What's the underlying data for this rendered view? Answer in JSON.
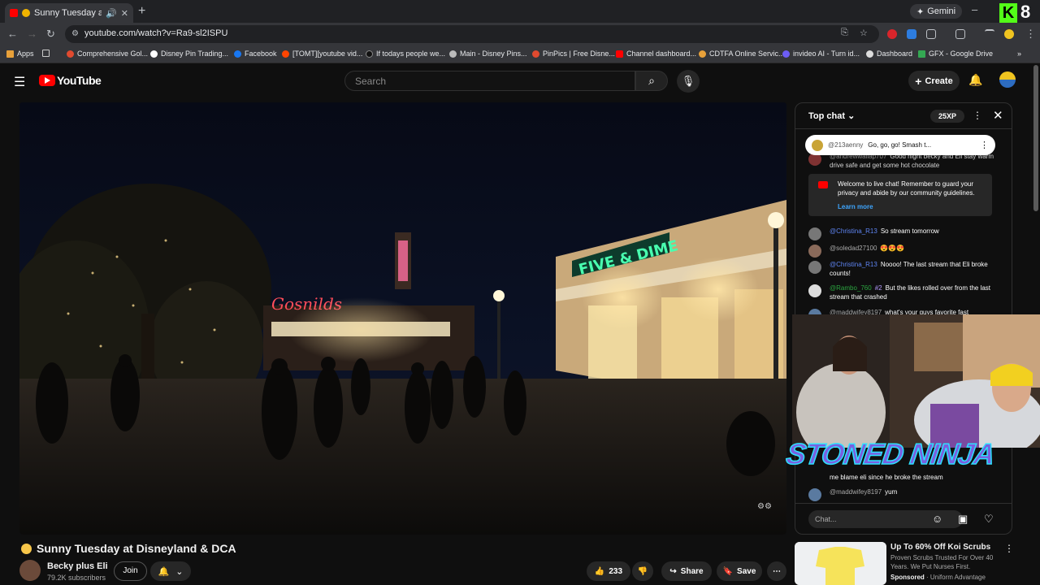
{
  "browser": {
    "tab_title": "Sunny Tuesday at Disne",
    "gemini_label": "Gemini",
    "url": "youtube.com/watch?v=Ra9-sl2ISPU",
    "bookmarks": [
      "Apps",
      "Comprehensive Gol...",
      "Disney Pin Trading...",
      "Facebook",
      "[TOMT][youtube vid...",
      "If todays people we...",
      "Main - Disney Pins...",
      "PinPics | Free Disne...",
      "Channel dashboard...",
      "CDTFA Online Servic...",
      "invideo AI - Turn id...",
      "Dashboard",
      "GFX - Google Drive"
    ],
    "badge_number": "8"
  },
  "youtube": {
    "logo_text": "YouTube",
    "search_placeholder": "Search",
    "create_label": "Create"
  },
  "video": {
    "title": "Sunny Tuesday at Disneyland & DCA",
    "channel_name": "Becky plus Eli",
    "subscribers": "79.2K subscribers",
    "join_label": "Join",
    "likes": "233",
    "share_label": "Share",
    "save_label": "Save"
  },
  "chat": {
    "header": "Top chat",
    "xp": "25XP",
    "pinned": {
      "user": "@213aenny",
      "text": "Go, go, go! Smash t..."
    },
    "messages_top": {
      "user": "@andrewwallap707",
      "text": "Good night becky and Eli stay warm drive safe and get some hot chocolate"
    },
    "welcome_text": "Welcome to live chat! Remember to guard your privacy and abide by our community guidelines.",
    "welcome_link": "Learn more",
    "messages": [
      {
        "user": "@Christina_R13",
        "text": "So stream tomorrow",
        "style": "mod"
      },
      {
        "user": "@soledad27100",
        "text": "",
        "style": ""
      },
      {
        "user": "@Christina_R13",
        "text": "Noooo! The last stream that Eli broke counts!",
        "style": "mod"
      },
      {
        "user": "@Rambo_760",
        "text": "But the likes rolled over from the last stream that crashed",
        "style": "green",
        "badge": "#2"
      },
      {
        "user": "@maddwifey8197",
        "text": "what's your guys favorite fast",
        "style": ""
      },
      {
        "user": "",
        "text": "me blame eli since he broke the stream",
        "style": ""
      },
      {
        "user": "@maddwifey8197",
        "text": "yum",
        "style": ""
      }
    ],
    "input_placeholder": "Chat..."
  },
  "overlay": {
    "logo_text": "STONED NINJA"
  },
  "ad": {
    "title": "Up To 60% Off Koi Scrubs",
    "description": "Proven Scrubs Trusted For Over 40 Years. We Put Nurses First.",
    "sponsored": "Sponsored",
    "advertiser": "Uniform Advantage"
  },
  "colors": {
    "accent": "#ff0000",
    "link": "#3ea6ff",
    "mod": "#5e84f1"
  }
}
